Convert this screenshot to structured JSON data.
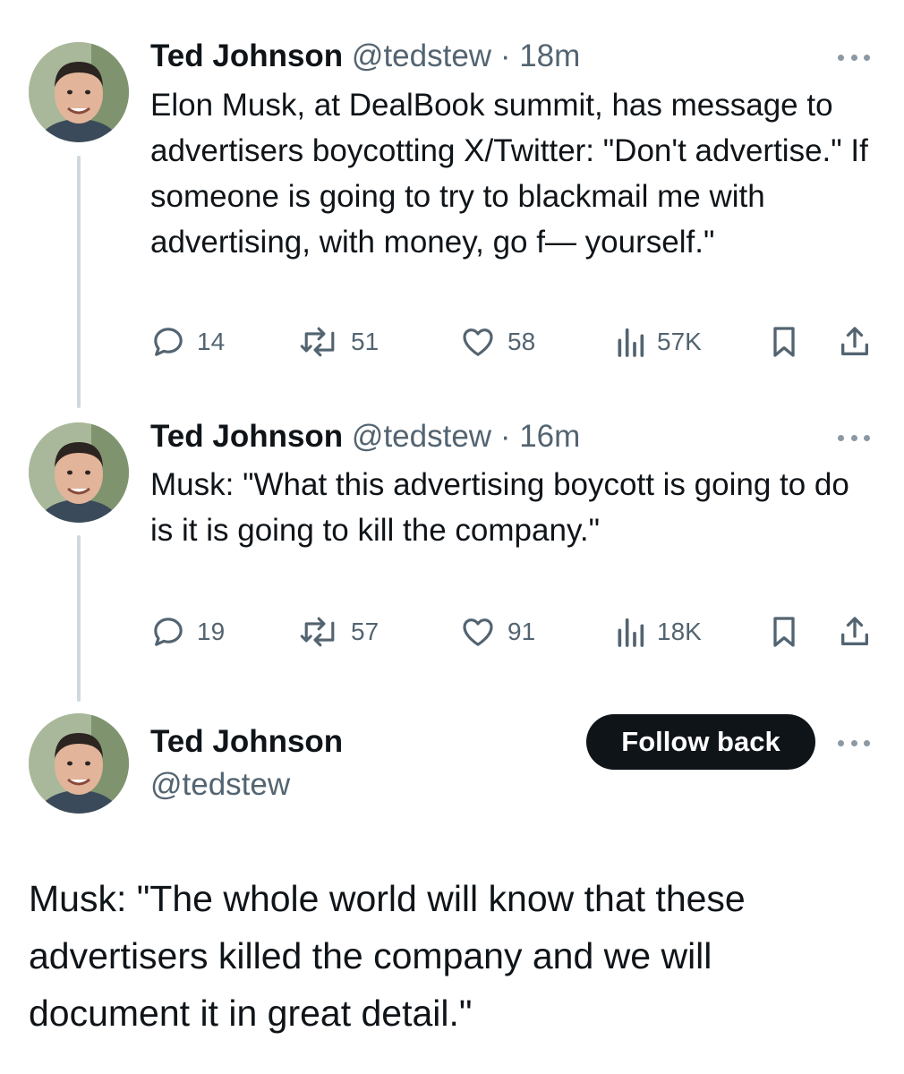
{
  "colors": {
    "text": "#0f1419",
    "muted": "#536471",
    "thread_line": "#cfd9de",
    "button_bg": "#0f1419"
  },
  "tweets": [
    {
      "name": "Ted Johnson",
      "handle": "@tedstew",
      "dot": "·",
      "time": "18m",
      "text": "Elon Musk, at DealBook summit, has message to advertisers boycotting X/Twitter: \"Don't advertise.\" If someone is going to try to blackmail me with advertising, with money, go f— yourself.\"",
      "replies": "14",
      "retweets": "51",
      "likes": "58",
      "views": "57K"
    },
    {
      "name": "Ted Johnson",
      "handle": "@tedstew",
      "dot": "·",
      "time": "16m",
      "text": "Musk: \"What this advertising boycott is going to do is it is going to kill the company.\"",
      "replies": "19",
      "retweets": "57",
      "likes": "91",
      "views": "18K"
    }
  ],
  "main_tweet": {
    "name": "Ted Johnson",
    "handle": "@tedstew",
    "follow_label": "Follow back",
    "text": "Musk: \"The whole world will know that these advertisers killed the company and we will document it in great detail.\""
  },
  "icons": {
    "reply": "speech-bubble-icon",
    "retweet": "retweet-arrows-icon",
    "like": "heart-icon",
    "views": "bar-chart-icon",
    "bookmark": "bookmark-icon",
    "share": "share-upload-icon",
    "more": "ellipsis-icon"
  }
}
